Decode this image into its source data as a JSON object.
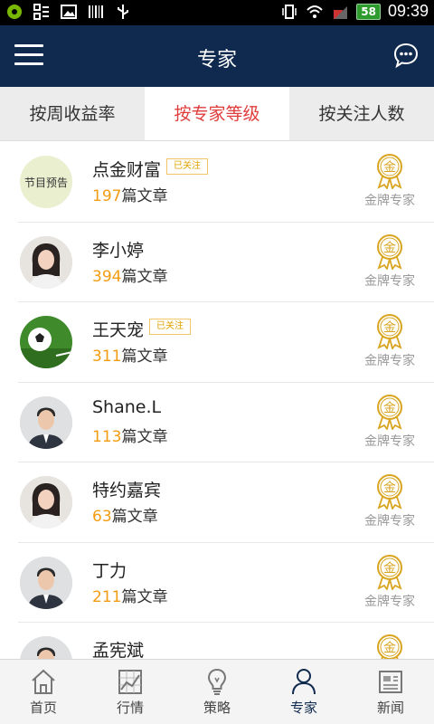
{
  "status_bar": {
    "time": "09:39",
    "battery": "58"
  },
  "header": {
    "title": "专家"
  },
  "tabs": [
    {
      "label": "按周收益率",
      "active": false
    },
    {
      "label": "按专家等级",
      "active": true
    },
    {
      "label": "按关注人数",
      "active": false
    }
  ],
  "experts": [
    {
      "name": "点金财富",
      "followed": true,
      "follow_label": "已关注",
      "article_count": "197",
      "article_suffix": "篇文章",
      "level": "金牌专家",
      "avatar_text": "节目预告",
      "avatar": "program-logo"
    },
    {
      "name": "李小婷",
      "followed": false,
      "follow_label": "",
      "article_count": "394",
      "article_suffix": "篇文章",
      "level": "金牌专家",
      "avatar": "woman-portrait"
    },
    {
      "name": "王天宠",
      "followed": true,
      "follow_label": "已关注",
      "article_count": "311",
      "article_suffix": "篇文章",
      "level": "金牌专家",
      "avatar": "soccer-ball"
    },
    {
      "name": "Shane.L",
      "followed": false,
      "follow_label": "",
      "article_count": "113",
      "article_suffix": "篇文章",
      "level": "金牌专家",
      "avatar": "man-portrait"
    },
    {
      "name": "特约嘉宾",
      "followed": false,
      "follow_label": "",
      "article_count": "63",
      "article_suffix": "篇文章",
      "level": "金牌专家",
      "avatar": "woman-portrait"
    },
    {
      "name": "丁力",
      "followed": false,
      "follow_label": "",
      "article_count": "211",
      "article_suffix": "篇文章",
      "level": "金牌专家",
      "avatar": "man-portrait"
    },
    {
      "name": "孟宪斌",
      "followed": false,
      "follow_label": "",
      "article_count": "",
      "article_suffix": "",
      "level": "",
      "avatar": "man-portrait"
    }
  ],
  "medal_glyph": "金",
  "bottom_nav": [
    {
      "label": "首页",
      "icon": "home-icon",
      "active": false
    },
    {
      "label": "行情",
      "icon": "chart-icon",
      "active": false
    },
    {
      "label": "策略",
      "icon": "lightbulb-icon",
      "active": false
    },
    {
      "label": "专家",
      "icon": "person-icon",
      "active": true
    },
    {
      "label": "新闻",
      "icon": "news-icon",
      "active": false
    }
  ],
  "colors": {
    "header": "#0f2a4e",
    "active_tab": "#e03c3c",
    "article_count": "#f39c12",
    "medal": "#d9a520"
  }
}
